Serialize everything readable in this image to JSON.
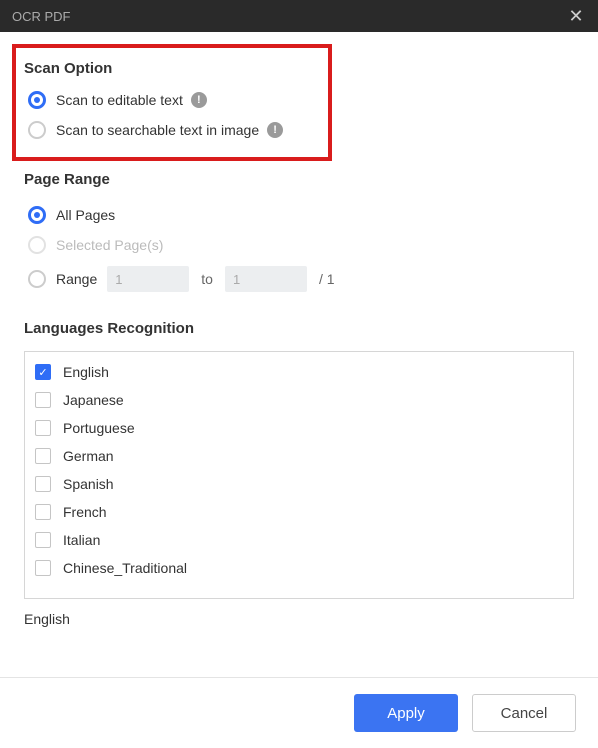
{
  "titlebar": {
    "title": "OCR PDF"
  },
  "scan": {
    "title": "Scan Option",
    "opt1": "Scan to editable text",
    "opt2": "Scan to searchable text in image"
  },
  "pageRange": {
    "title": "Page Range",
    "all": "All Pages",
    "selected": "Selected Page(s)",
    "range": "Range",
    "from": "1",
    "to_label": "to",
    "to": "1",
    "total": "/ 1"
  },
  "languages": {
    "title": "Languages Recognition",
    "items": [
      "English",
      "Japanese",
      "Portuguese",
      "German",
      "Spanish",
      "French",
      "Italian",
      "Chinese_Traditional"
    ],
    "selected_summary": "English"
  },
  "footer": {
    "apply": "Apply",
    "cancel": "Cancel"
  }
}
